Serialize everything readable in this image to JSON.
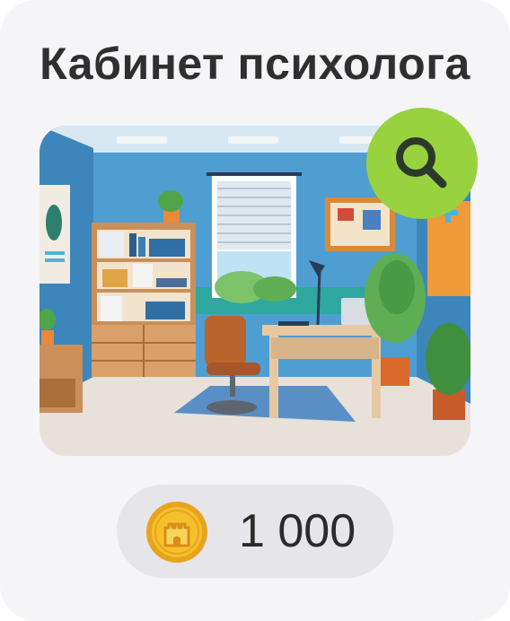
{
  "card": {
    "title": "Кабинет психолога"
  },
  "price": {
    "value": "1 000",
    "currency_icon": "castle-coin-icon"
  },
  "actions": {
    "zoom_icon": "search-icon"
  },
  "colors": {
    "card_background": "#f5f4f7",
    "search_button": "#99d23f",
    "price_pill": "#e6e5e9",
    "coin_gold": "#f6c02c",
    "title_text": "#2f2f2f"
  }
}
